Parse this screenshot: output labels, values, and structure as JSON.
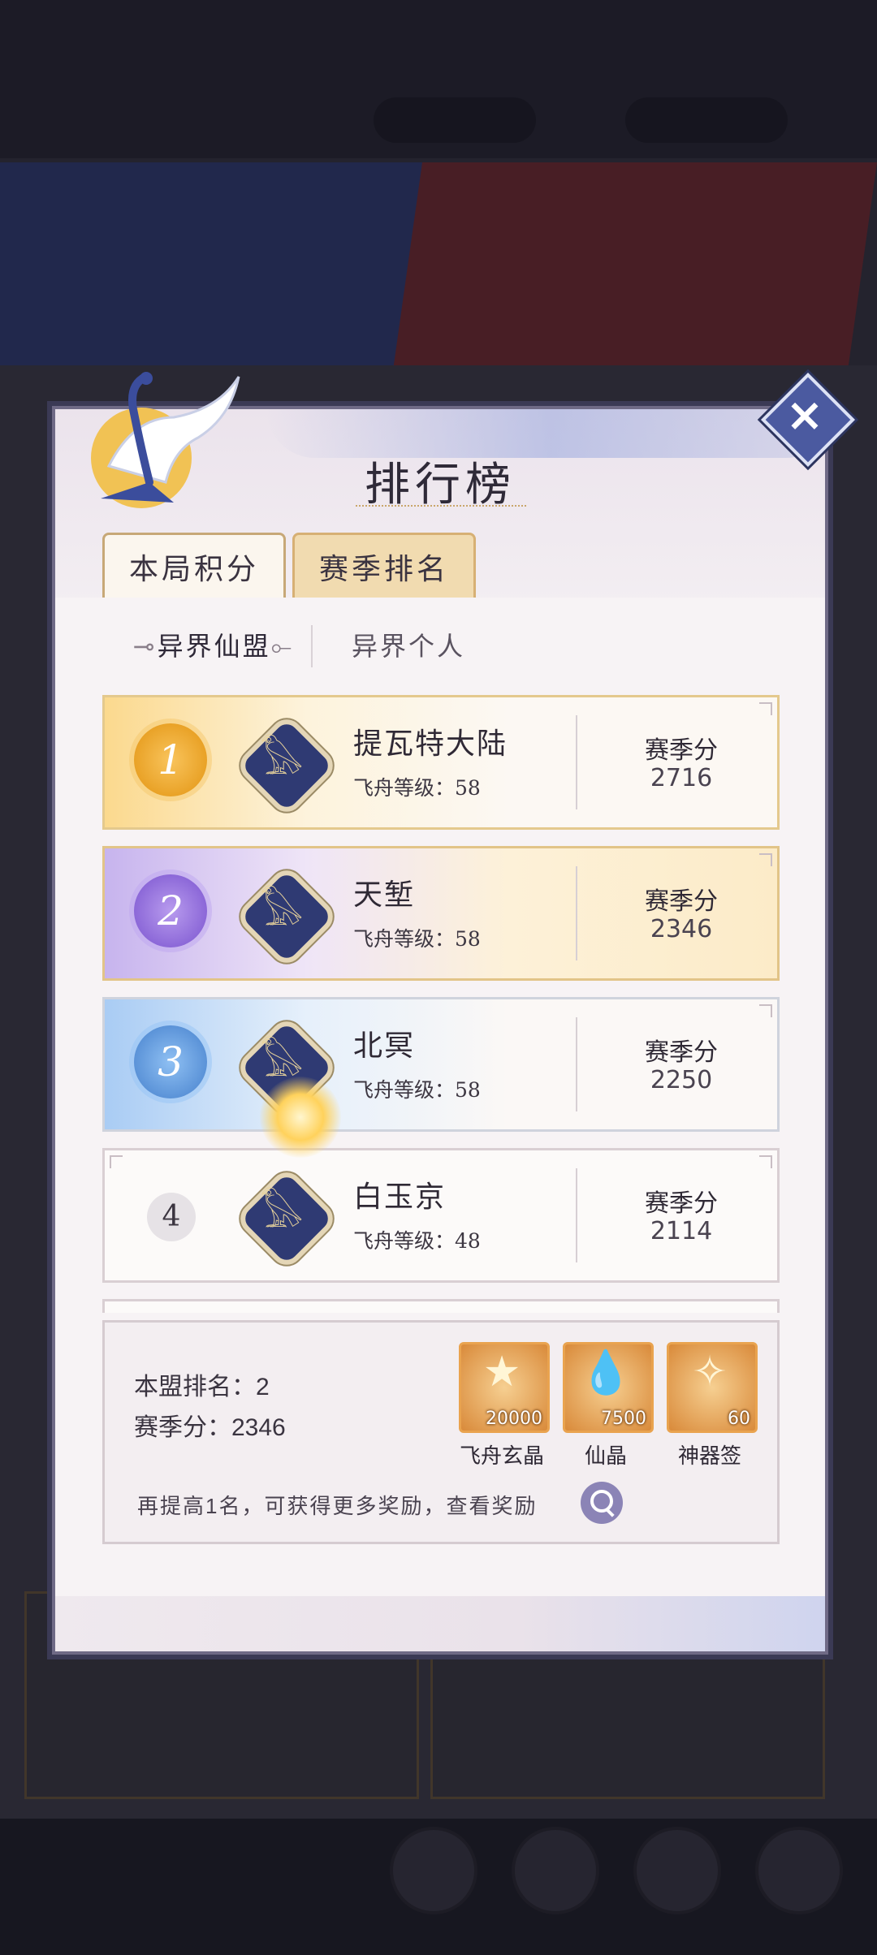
{
  "panel": {
    "title": "排行榜",
    "tabs": [
      "本局积分",
      "赛季排名"
    ],
    "subtabs": [
      "异界仙盟",
      "异界个人"
    ]
  },
  "rankings": [
    {
      "rank": "1",
      "name": "提瓦特大陆",
      "level": "飞舟等级：58",
      "score_label": "赛季分",
      "score": "2716"
    },
    {
      "rank": "2",
      "name": "天堑",
      "level": "飞舟等级：58",
      "score_label": "赛季分",
      "score": "2346"
    },
    {
      "rank": "3",
      "name": "北冥",
      "level": "飞舟等级：58",
      "score_label": "赛季分",
      "score": "2250"
    },
    {
      "rank": "4",
      "name": "白玉京",
      "level": "飞舟等级：48",
      "score_label": "赛季分",
      "score": "2114"
    }
  ],
  "my_alliance": {
    "rank_text": "本盟排名：2",
    "score_text": "赛季分：2346",
    "hint": "再提高1名，可获得更多奖励，查看奖励"
  },
  "rewards": [
    {
      "icon": "star-crystal-icon",
      "count": "20000",
      "name": "飞舟玄晶"
    },
    {
      "icon": "droplet-crystal-icon",
      "count": "7500",
      "name": "仙晶"
    },
    {
      "icon": "artifact-lot-icon",
      "count": "60",
      "name": "神器签"
    }
  ],
  "colors": {
    "accent_gold": "#e9a227",
    "accent_purple": "#8c68d8",
    "accent_blue": "#5b93d8",
    "close_button": "#4b5aa0"
  }
}
